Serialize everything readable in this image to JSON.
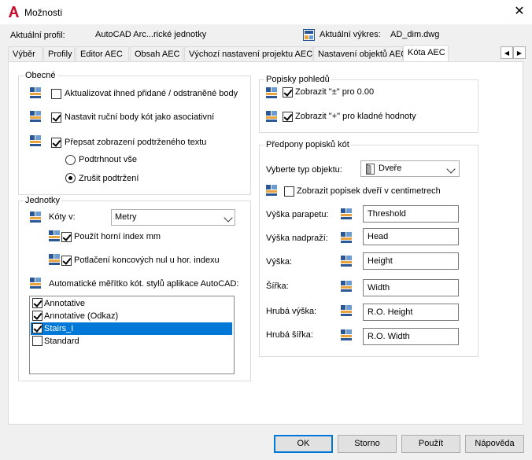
{
  "window": {
    "title": "Možnosti",
    "close_glyph": "✕"
  },
  "header": {
    "profile_label": "Aktuální profil:",
    "profile_value": "AutoCAD Arc...rické jednotky",
    "drawing_label": "Aktuální výkres:",
    "drawing_value": "AD_dim.dwg"
  },
  "tabs": [
    {
      "label": "Výběr"
    },
    {
      "label": "Profily"
    },
    {
      "label": "Editor AEC"
    },
    {
      "label": "Obsah AEC"
    },
    {
      "label": "Výchozí nastavení projektu AEC"
    },
    {
      "label": "Nastavení objektů AEC"
    },
    {
      "label": "Kóta AEC",
      "active": true
    }
  ],
  "tab_nav": {
    "prev": "◀",
    "next": "▶"
  },
  "general": {
    "title": "Obecné",
    "auto_update": {
      "label": "Aktualizovat ihned přidané / odstraněné body",
      "checked": false
    },
    "manual_points": {
      "label": "Nastavit ruční body kót jako asociativní",
      "checked": true
    },
    "override_underline": {
      "label": "Přepsat zobrazení podtrženého textu",
      "checked": true
    },
    "underline_all": {
      "label": "Podtrhnout vše",
      "selected": false
    },
    "remove_underline": {
      "label": "Zrušit podtržení",
      "selected": true
    }
  },
  "units": {
    "title": "Jednotky",
    "dims_in_label": "Kóty v:",
    "dims_in_value": "Metry",
    "superscript": {
      "label": "Použít horní index mm",
      "checked": true
    },
    "suppress_zeros": {
      "label": "Potlačení koncových nul u hor. indexu",
      "checked": true
    },
    "autoscale_label": "Automatické měřítko kót. stylů aplikace AutoCAD:",
    "styles": [
      {
        "label": "Annotative",
        "checked": true,
        "selected": false
      },
      {
        "label": "Annotative (Odkaz)",
        "checked": true,
        "selected": false
      },
      {
        "label": "Stairs_I",
        "checked": true,
        "selected": true
      },
      {
        "label": "Standard",
        "checked": false,
        "selected": false
      }
    ]
  },
  "view_labels": {
    "title": "Popisky pohledů",
    "show_pm": {
      "label": "Zobrazit \"±\" pro 0.00",
      "checked": true
    },
    "show_plus": {
      "label": "Zobrazit \"+\" pro kladné hodnoty",
      "checked": true
    }
  },
  "prefixes": {
    "title": "Předpony popisků kót",
    "object_type_label": "Vyberte typ objektu:",
    "object_type_value": "Dveře",
    "show_door_cm": {
      "label": "Zobrazit popisek dveří v centimetrech",
      "checked": false
    },
    "rows": [
      {
        "label": "Výška parapetu:",
        "value": "Threshold"
      },
      {
        "label": "Výška nadpraží:",
        "value": "Head"
      },
      {
        "label": "Výška:",
        "value": "Height"
      },
      {
        "label": "Šířka:",
        "value": "Width"
      },
      {
        "label": "Hrubá výška:",
        "value": "R.O. Height"
      },
      {
        "label": "Hrubá šířka:",
        "value": "R.O. Width"
      }
    ]
  },
  "buttons": {
    "ok": "OK",
    "cancel": "Storno",
    "apply": "Použít",
    "help": "Nápověda"
  },
  "colors": {
    "accent": "#0078d7",
    "app_icon": "#c8102e"
  }
}
